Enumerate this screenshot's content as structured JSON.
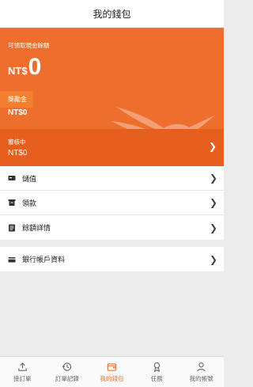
{
  "header": {
    "title": "我的錢包"
  },
  "wallet": {
    "available_label": "可領取現金餘額",
    "currency": "NT$",
    "available_amount": "0",
    "bonus_label": "獎勵金",
    "bonus_amount": "NT$0",
    "review_label": "審核中",
    "review_amount": "NT$0"
  },
  "menu": {
    "items": [
      {
        "label": "儲值",
        "icon": "topup-icon"
      },
      {
        "label": "領款",
        "icon": "withdraw-icon"
      },
      {
        "label": "餘額詳情",
        "icon": "balance-detail-icon"
      }
    ],
    "bank": {
      "label": "銀行帳戶資料",
      "icon": "bank-card-icon"
    }
  },
  "tabbar": {
    "tabs": [
      {
        "label": "接訂單",
        "icon": "upload-icon",
        "active": false
      },
      {
        "label": "訂單記錄",
        "icon": "history-icon",
        "active": false
      },
      {
        "label": "我的錢包",
        "icon": "wallet-icon",
        "active": true
      },
      {
        "label": "任務",
        "icon": "medal-icon",
        "active": false
      },
      {
        "label": "我的帳號",
        "icon": "person-icon",
        "active": false
      }
    ]
  },
  "colors": {
    "accent": "#ee6e2d",
    "bonus_tag": "#f4802f",
    "review_bg": "#e65f1f"
  }
}
